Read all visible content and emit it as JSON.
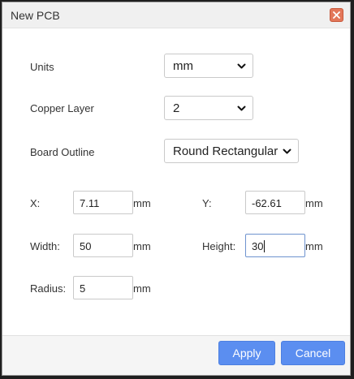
{
  "dialog": {
    "title": "New PCB",
    "close_icon": "close-icon"
  },
  "form": {
    "units": {
      "label": "Units",
      "value": "mm"
    },
    "copper_layer": {
      "label": "Copper Layer",
      "value": "2"
    },
    "board_outline": {
      "label": "Board Outline",
      "value": "Round Rectangular"
    },
    "x": {
      "label": "X:",
      "value": "7.11",
      "unit": "mm"
    },
    "y": {
      "label": "Y:",
      "value": "-62.61",
      "unit": "mm"
    },
    "width": {
      "label": "Width:",
      "value": "50",
      "unit": "mm"
    },
    "height": {
      "label": "Height:",
      "value": "30",
      "unit": "mm"
    },
    "radius": {
      "label": "Radius:",
      "value": "5",
      "unit": "mm"
    }
  },
  "footer": {
    "apply_label": "Apply",
    "cancel_label": "Cancel"
  },
  "colors": {
    "accent": "#5b8ef0",
    "close": "#e3775a"
  }
}
